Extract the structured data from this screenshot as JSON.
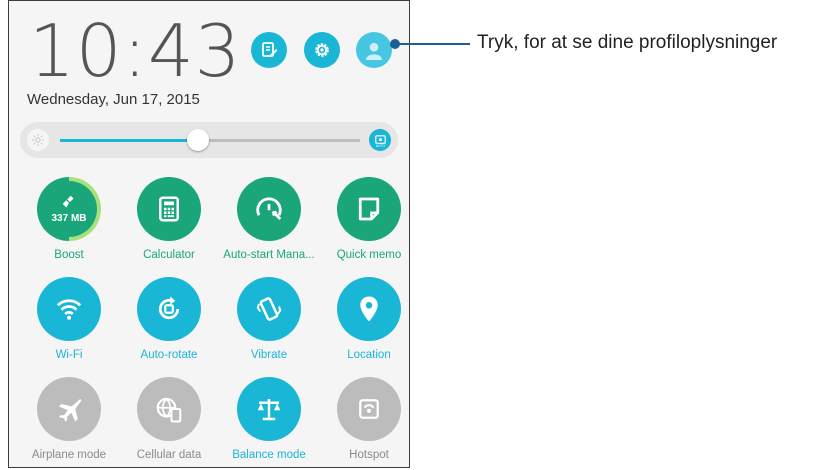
{
  "header": {
    "time": "10:43",
    "date": "Wednesday, Jun 17, 2015"
  },
  "header_icons": [
    "edit-icon",
    "settings-gear-icon",
    "profile-avatar-icon"
  ],
  "brightness": {
    "level": 0.46,
    "auto_icon": "auto-brightness-icon",
    "auto_label": "AUTO"
  },
  "tiles": [
    {
      "label": "Boost",
      "state": "green",
      "icon": "broom-icon",
      "value": "337 MB",
      "ring_fraction": 0.5
    },
    {
      "label": "Calculator",
      "state": "green",
      "icon": "calculator-icon"
    },
    {
      "label": "Auto-start Mana...",
      "state": "green",
      "icon": "gauge-wrench-icon"
    },
    {
      "label": "Quick memo",
      "state": "green",
      "icon": "memo-icon"
    },
    {
      "label": "Wi-Fi",
      "state": "on",
      "icon": "wifi-icon"
    },
    {
      "label": "Auto-rotate",
      "state": "on",
      "icon": "auto-rotate-icon"
    },
    {
      "label": "Vibrate",
      "state": "on",
      "icon": "vibrate-icon"
    },
    {
      "label": "Location",
      "state": "on",
      "icon": "location-pin-icon"
    },
    {
      "label": "Airplane mode",
      "state": "off",
      "icon": "airplane-icon"
    },
    {
      "label": "Cellular data",
      "state": "off",
      "icon": "cellular-globe-icon"
    },
    {
      "label": "Balance mode",
      "state": "on",
      "icon": "balance-scale-icon"
    },
    {
      "label": "Hotspot",
      "state": "off",
      "icon": "hotspot-icon"
    }
  ],
  "callout": {
    "text": "Tryk, for at se dine profiloplysninger"
  },
  "colors": {
    "accent": "#19b6d6",
    "green": "#1aa67a",
    "off": "#bcbcbc",
    "callout_line": "#1d5f95"
  }
}
